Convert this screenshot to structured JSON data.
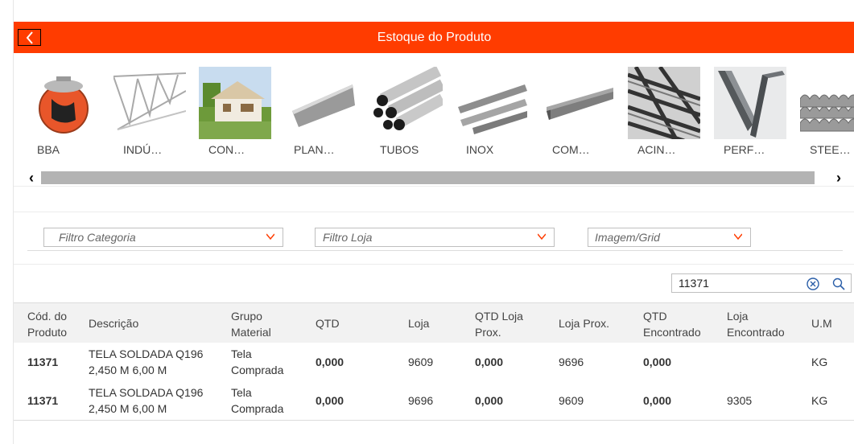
{
  "header": {
    "title": "Estoque do Produto",
    "back_icon": "chevron-left-icon"
  },
  "categories": [
    {
      "label": "BBA",
      "image": "barbed-wire-coil"
    },
    {
      "label": "INDÚ…",
      "image": "lattice-truss"
    },
    {
      "label": "CON…",
      "image": "house"
    },
    {
      "label": "PLAN…",
      "image": "steel-sheet"
    },
    {
      "label": "TUBOS",
      "image": "pipes-bundle"
    },
    {
      "label": "INOX",
      "image": "stainless-flat-bars"
    },
    {
      "label": "COM…",
      "image": "u-channel"
    },
    {
      "label": "ACIN…",
      "image": "rebar"
    },
    {
      "label": "PERF…",
      "image": "angle-profiles"
    },
    {
      "label": "STEE…",
      "image": "corrugated-sheets"
    }
  ],
  "filters": {
    "categoria_placeholder": "Filtro Categoria",
    "loja_placeholder": "Filtro Loja",
    "view_placeholder": "Imagem/Grid"
  },
  "search": {
    "value": "11371"
  },
  "table": {
    "headers": {
      "cod_l1": "Cód. do",
      "cod_l2": "Produto",
      "descricao": "Descrição",
      "grupo_l1": "Grupo",
      "grupo_l2": "Material",
      "qtd": "QTD",
      "loja": "Loja",
      "qtdprox_l1": "QTD Loja",
      "qtdprox_l2": "Prox.",
      "lojaprox": "Loja Prox.",
      "qtdenc_l1": "QTD",
      "qtdenc_l2": "Encontrado",
      "lojaenc_l1": "Loja",
      "lojaenc_l2": "Encontrado",
      "um": "U.M"
    },
    "rows": [
      {
        "cod": "11371",
        "desc_l1": "TELA SOLDADA Q196",
        "desc_l2": "2,450 M 6,00 M",
        "grupo_l1": "Tela",
        "grupo_l2": "Comprada",
        "qtd": "0,000",
        "loja": "9609",
        "qtd_prox": "0,000",
        "loja_prox": "9696",
        "qtd_enc": "0,000",
        "loja_enc": "",
        "um": "KG"
      },
      {
        "cod": "11371",
        "desc_l1": "TELA SOLDADA Q196",
        "desc_l2": "2,450 M 6,00 M",
        "grupo_l1": "Tela",
        "grupo_l2": "Comprada",
        "qtd": "0,000",
        "loja": "9696",
        "qtd_prox": "0,000",
        "loja_prox": "9609",
        "qtd_enc": "0,000",
        "loja_enc": "9305",
        "um": "KG"
      }
    ]
  },
  "colors": {
    "accent": "#ff3c00",
    "chevron": "#ff3c00"
  }
}
